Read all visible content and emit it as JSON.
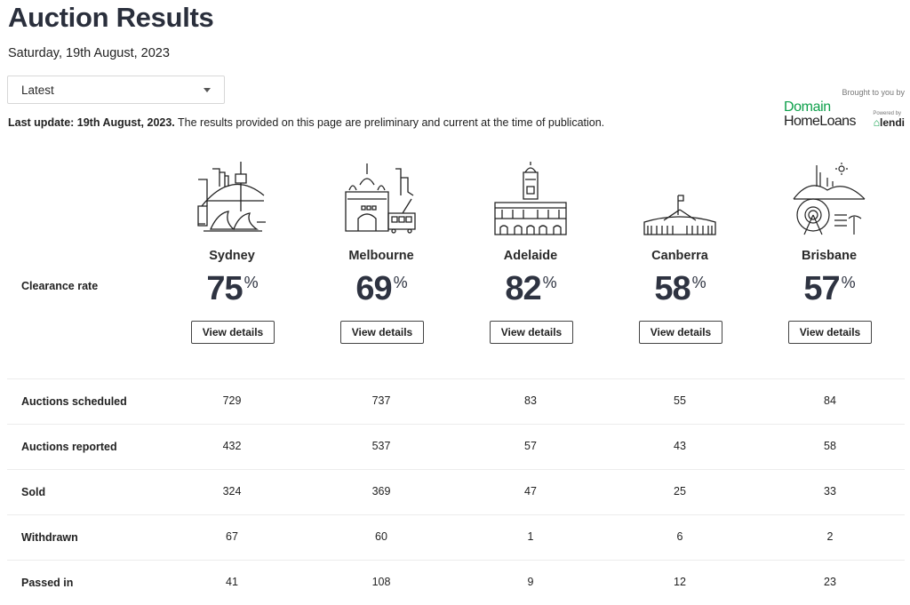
{
  "header": {
    "title": "Auction Results",
    "date": "Saturday, 19th August, 2023",
    "period_select": {
      "value": "Latest"
    },
    "update_bold": "Last update: 19th August, 2023.",
    "update_text": " The results provided on this page are preliminary and current at the time of publication."
  },
  "sponsor": {
    "brought_by": "Brought to you by",
    "brand_line1": "Domain",
    "brand_line2": "HomeLoans",
    "powered_by": "Powered by",
    "partner": "lendi",
    "brand_color": "#0ea04b"
  },
  "clearance_label": "Clearance rate",
  "percent_sign": "%",
  "cities": [
    {
      "name": "Sydney",
      "icon": "sydney-skyline-icon",
      "clearance_rate": "75",
      "button": "View details"
    },
    {
      "name": "Melbourne",
      "icon": "melbourne-skyline-icon",
      "clearance_rate": "69",
      "button": "View details"
    },
    {
      "name": "Adelaide",
      "icon": "adelaide-town-hall-icon",
      "clearance_rate": "82",
      "button": "View details"
    },
    {
      "name": "Canberra",
      "icon": "canberra-parliament-icon",
      "clearance_rate": "58",
      "button": "View details"
    },
    {
      "name": "Brisbane",
      "icon": "brisbane-skyline-icon",
      "clearance_rate": "57",
      "button": "View details"
    }
  ],
  "table": {
    "rows": [
      {
        "label": "Auctions scheduled",
        "values": [
          "729",
          "737",
          "83",
          "55",
          "84"
        ]
      },
      {
        "label": "Auctions reported",
        "values": [
          "432",
          "537",
          "57",
          "43",
          "58"
        ]
      },
      {
        "label": "Sold",
        "values": [
          "324",
          "369",
          "47",
          "25",
          "33"
        ]
      },
      {
        "label": "Withdrawn",
        "values": [
          "67",
          "60",
          "1",
          "6",
          "2"
        ]
      },
      {
        "label": "Passed in",
        "values": [
          "41",
          "108",
          "9",
          "12",
          "23"
        ]
      }
    ]
  }
}
